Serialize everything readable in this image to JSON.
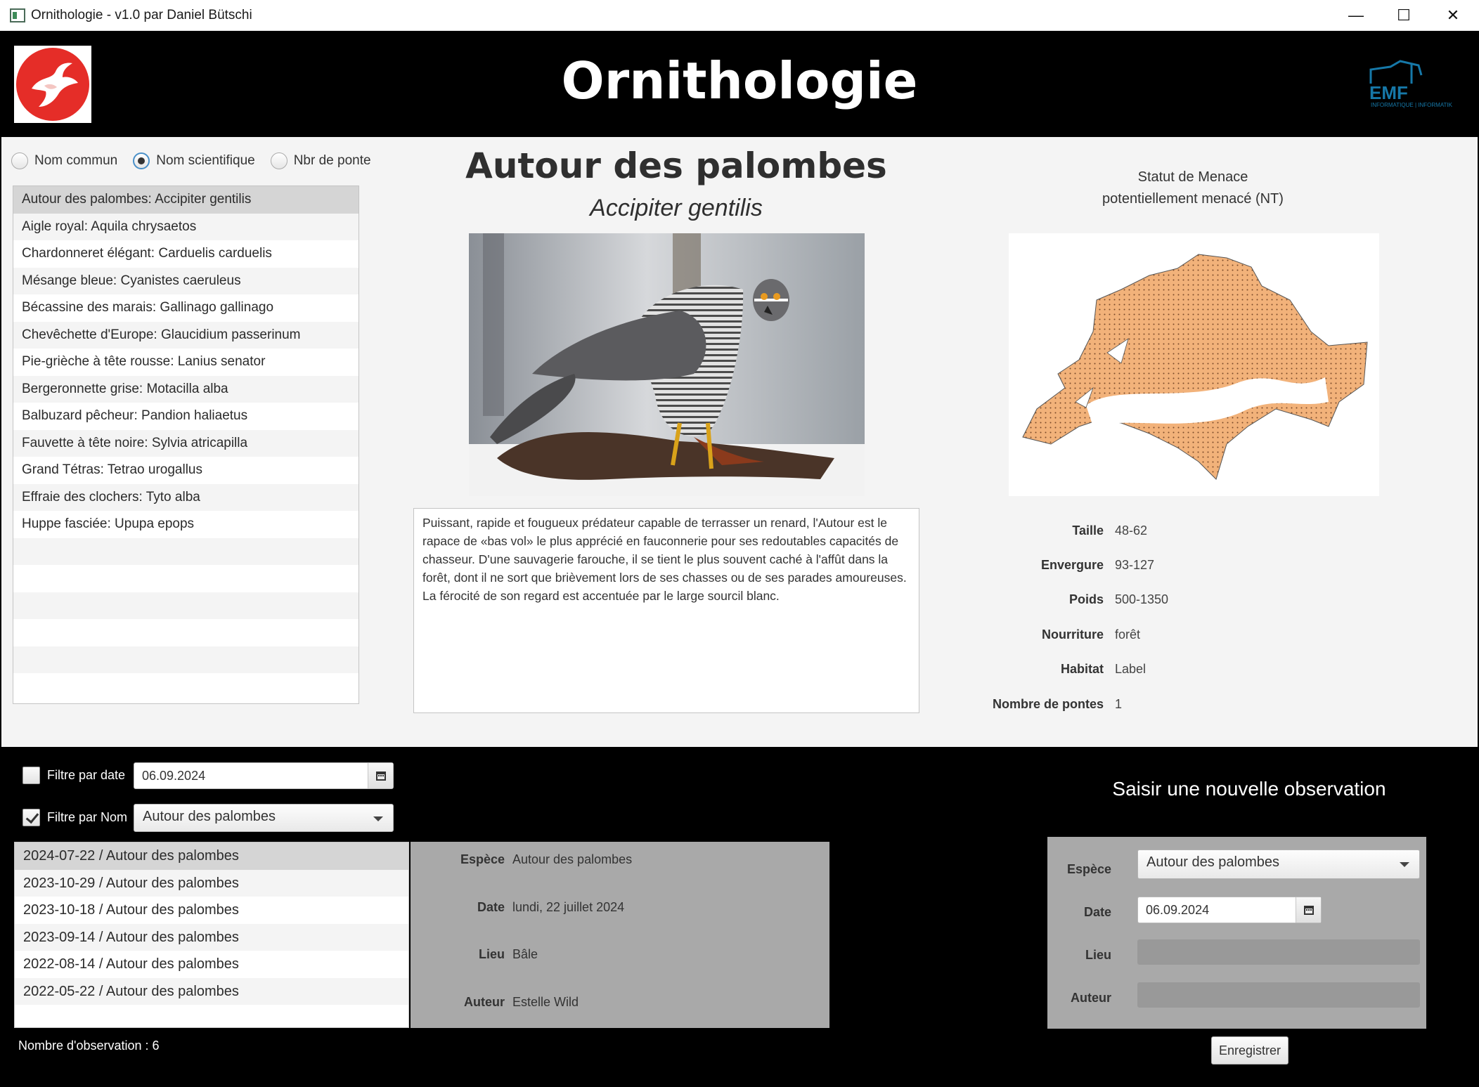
{
  "window": {
    "title": "Ornithologie - v1.0 par Daniel Bütschi",
    "minimize": "—",
    "maximize": "☐",
    "close": "✕"
  },
  "header": {
    "title": "Ornithologie",
    "partner_logo_text": "EMF",
    "partner_logo_sub": "INFORMATIQUE | INFORMATIK"
  },
  "sort": {
    "options": [
      "Nom commun",
      "Nom scientifique",
      "Nbr de ponte"
    ],
    "selected": "Nom scientifique"
  },
  "species_list": [
    "Autour des palombes: Accipiter gentilis",
    "Aigle royal: Aquila chrysaetos",
    "Chardonneret élégant: Carduelis carduelis",
    "Mésange bleue: Cyanistes caeruleus",
    "Bécassine des marais: Gallinago gallinago",
    "Chevêchette d'Europe: Glaucidium passerinum",
    "Pie-grièche à tête rousse: Lanius senator",
    "Bergeronnette grise: Motacilla alba",
    "Balbuzard pêcheur: Pandion haliaetus",
    "Fauvette à tête noire: Sylvia atricapilla",
    "Grand Tétras: Tetrao urogallus",
    "Effraie des clochers: Tyto alba",
    "Huppe fasciée: Upupa epops"
  ],
  "bird": {
    "name": "Autour des palombes",
    "scientific": "Accipiter gentilis",
    "description": "Puissant, rapide et fougueux prédateur capable de terrasser un renard, l'Autour est le rapace de «bas vol» le plus apprécié en fauconnerie pour ses redoutables capacités de chasseur. D'une sauvagerie farouche, il se tient le plus souvent caché à l'affût dans la forêt, dont il ne sort que brièvement lors de ses chasses ou de ses parades amoureuses. La férocité de son regard est accentuée par le large sourcil blanc.",
    "status_title": "Statut de Menace",
    "status_value": "potentiellement menacé (NT)",
    "map_color": "#f2b27a",
    "facts": {
      "taille_label": "Taille",
      "taille": "48-62",
      "envergure_label": "Envergure",
      "envergure": "93-127",
      "poids_label": "Poids",
      "poids": "500-1350",
      "nourriture_label": "Nourriture",
      "nourriture": "forêt",
      "habitat_label": "Habitat",
      "habitat": "Label",
      "pontes_label": "Nombre de pontes",
      "pontes": "1"
    }
  },
  "filters": {
    "date_label": "Filtre par date",
    "date_checked": false,
    "date_value": "06.09.2024",
    "name_label": "Filtre par Nom",
    "name_checked": true,
    "name_value": "Autour des palombes"
  },
  "observations": [
    "2024-07-22 / Autour des palombes",
    "2023-10-29 / Autour des palombes",
    "2023-10-18 / Autour des palombes",
    "2023-09-14 / Autour des palombes",
    "2022-08-14 / Autour des palombes",
    "2022-05-22 / Autour des palombes"
  ],
  "observation_detail": {
    "espece_label": "Espèce",
    "espece": "Autour des palombes",
    "date_label": "Date",
    "date": "lundi, 22 juillet 2024",
    "lieu_label": "Lieu",
    "lieu": "Bâle",
    "auteur_label": "Auteur",
    "auteur": "Estelle Wild"
  },
  "observation_count": "Nombre d'observation : 6",
  "new_observation": {
    "title": "Saisir une nouvelle observation",
    "espece_label": "Espèce",
    "espece_value": "Autour des palombes",
    "date_label": "Date",
    "date_value": "06.09.2024",
    "lieu_label": "Lieu",
    "lieu_value": "",
    "auteur_label": "Auteur",
    "auteur_value": "",
    "save_label": "Enregistrer"
  }
}
